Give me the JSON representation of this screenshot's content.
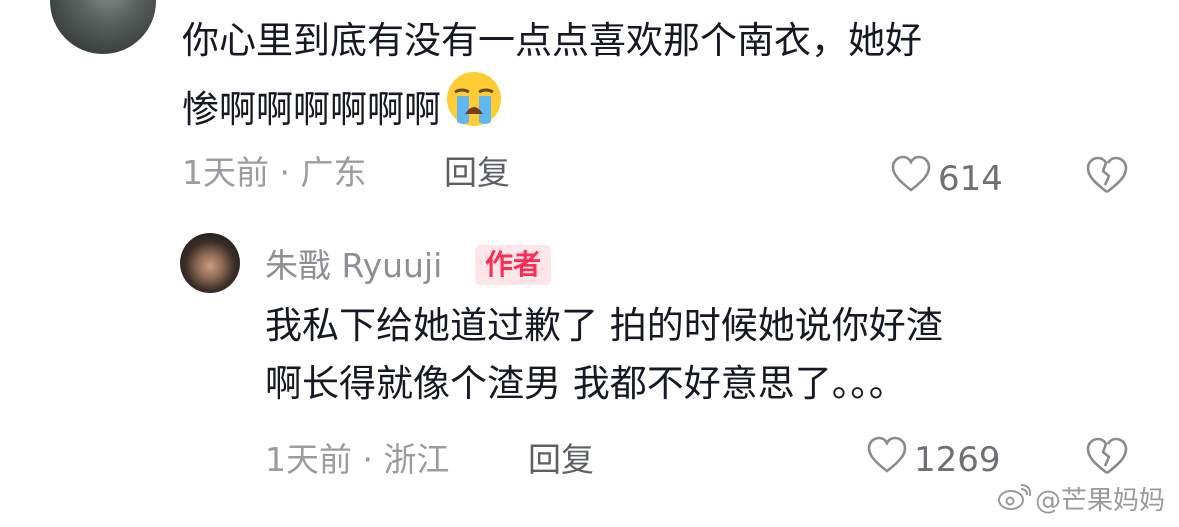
{
  "comments": [
    {
      "body_lines": [
        "你心里到底有没有一点点喜欢那个南衣，她好",
        "惨啊啊啊啊啊啊"
      ],
      "emoji": "loudly-crying-face-emoji",
      "meta": "1天前 · 广东",
      "reply_label": "回复",
      "likes": "614"
    }
  ],
  "reply": {
    "username": "朱戬 Ryuuji",
    "badge": "作者",
    "body_lines": [
      "我私下给她道过歉了 拍的时候她说你好渣",
      "啊长得就像个渣男 我都不好意思了。。。"
    ],
    "meta": "1天前 · 浙江",
    "reply_label": "回复",
    "likes": "1269"
  },
  "watermark": {
    "text": "@芒果妈妈",
    "icon": "weibo-icon"
  },
  "colors": {
    "badge_text": "#fe2c55",
    "badge_bg": "#fde5ea",
    "meta": "#9b9ca0",
    "body": "#161823"
  }
}
